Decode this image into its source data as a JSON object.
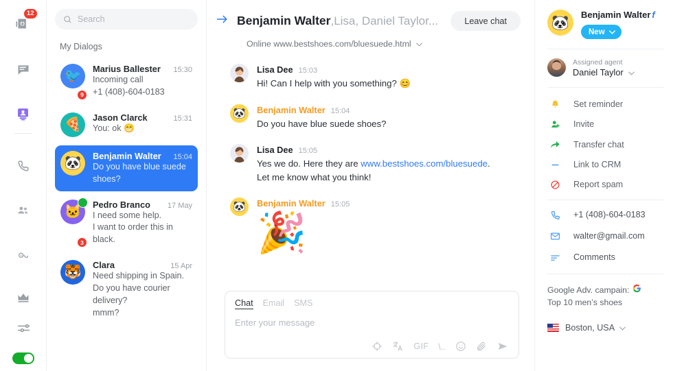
{
  "rail": {
    "items": [
      {
        "name": "inbox-icon",
        "badge": "12"
      },
      {
        "name": "chat-icon",
        "badge": ""
      },
      {
        "name": "contacts-icon",
        "badge": ""
      },
      {
        "name": "phone-icon",
        "badge": ""
      },
      {
        "name": "team-icon",
        "badge": ""
      },
      {
        "name": "analytics-icon",
        "badge": ""
      },
      {
        "name": "crown-icon",
        "badge": ""
      },
      {
        "name": "settings-sliders-icon",
        "badge": ""
      }
    ],
    "toggle_state": "on"
  },
  "search": {
    "placeholder": "Search",
    "value": ""
  },
  "dialogs": {
    "title": "My Dialogs",
    "items": [
      {
        "name": "Marius Ballester",
        "time": "15:30",
        "lines": [
          "Incoming call",
          "+1 (408)-604-0183"
        ],
        "avatar_emoji": "🐦",
        "avatar_color": "#4285f4",
        "badge": "9",
        "badge_color": "#f03a2e",
        "online": false,
        "selected": false
      },
      {
        "name": "Jason Clarck",
        "time": "15:31",
        "lines": [
          "You: ok 😁"
        ],
        "avatar_emoji": "🍕",
        "avatar_color": "#17b9b0",
        "badge": "",
        "badge_color": "",
        "online": false,
        "selected": false
      },
      {
        "name": "Benjamin Walter",
        "time": "15:04",
        "lines": [
          "Do you have blue suede",
          "shoes?"
        ],
        "avatar_emoji": "🐼",
        "avatar_color": "#ffd64d",
        "badge": "",
        "badge_color": "",
        "online": false,
        "selected": true
      },
      {
        "name": "Pedro Branco",
        "time": "17 May",
        "lines": [
          "I need some help.",
          "I want to order this in black."
        ],
        "avatar_emoji": "🐱",
        "avatar_color": "#8662f0",
        "badge": "3",
        "badge_color": "#f03a2e",
        "online": true,
        "selected": false
      },
      {
        "name": "Clara",
        "time": "15 Apr",
        "lines": [
          "Need shipping in Spain.",
          "Do you have courier delivery?",
          "mmm?"
        ],
        "avatar_emoji": "🐯",
        "avatar_color": "#2266dd",
        "badge": "",
        "badge_color": "",
        "online": false,
        "selected": false
      }
    ]
  },
  "chat": {
    "title_primary": "Benjamin Walter",
    "title_rest": ",Lisa, Daniel Taylor...",
    "leave_label": "Leave chat",
    "status": "Online www.bestshoes.com/bluesuede.html",
    "messages": [
      {
        "author": "Lisa Dee",
        "author_color": "default",
        "time": "15:03",
        "text": "Hi! Can I help with you something? 😊",
        "avatar_kind": "photo",
        "avatar_emoji": "",
        "avatar_color": "#e8eaf0",
        "link": "",
        "text_after_link": "",
        "second_line": "",
        "big_emoji": ""
      },
      {
        "author": "Benjamin Walter",
        "author_color": "orange",
        "time": "15:04",
        "text": "Do you have blue suede shoes?",
        "avatar_kind": "emoji",
        "avatar_emoji": "🐼",
        "avatar_color": "#ffd64d",
        "link": "",
        "text_after_link": "",
        "second_line": "",
        "big_emoji": ""
      },
      {
        "author": "Lisa Dee",
        "author_color": "default",
        "time": "15:05",
        "text": "Yes we do. Here they are ",
        "avatar_kind": "photo",
        "avatar_emoji": "",
        "avatar_color": "#e8eaf0",
        "link": "www.bestshoes.com/bluesuede",
        "text_after_link": ".",
        "second_line": "Let me know what you think!",
        "big_emoji": ""
      },
      {
        "author": "Benjamin Walter",
        "author_color": "orange",
        "time": "15:05",
        "text": "",
        "avatar_kind": "emoji",
        "avatar_emoji": "🐼",
        "avatar_color": "#ffd64d",
        "link": "",
        "text_after_link": "",
        "second_line": "",
        "big_emoji": "🎉"
      }
    ]
  },
  "composer": {
    "tabs": [
      {
        "label": "Chat",
        "active": true
      },
      {
        "label": "Email",
        "active": false
      },
      {
        "label": "SMS",
        "active": false
      }
    ],
    "placeholder": "Enter your message",
    "value": "",
    "tools": [
      {
        "name": "target-icon",
        "label": ""
      },
      {
        "name": "translate-icon",
        "label": ""
      },
      {
        "name": "gif-icon",
        "label": "GIF"
      },
      {
        "name": "shortcut-icon",
        "label": "\\.."
      },
      {
        "name": "emoji-icon",
        "label": ""
      },
      {
        "name": "attachment-icon",
        "label": ""
      },
      {
        "name": "send-icon",
        "label": ""
      }
    ]
  },
  "info": {
    "contact_name": "Benjamin Walter",
    "facebook_mark": "f",
    "avatar_emoji": "🐼",
    "status_pill": "New",
    "assigned_label": "Assigned agent",
    "assigned_name": "Daniel Taylor",
    "actions": [
      {
        "label": "Set reminder",
        "icon": "bell-icon",
        "color": "#f7c12f"
      },
      {
        "label": "Invite",
        "icon": "add-person-icon",
        "color": "#21b14a"
      },
      {
        "label": "Transfer chat",
        "icon": "transfer-arrow-icon",
        "color": "#21b14a"
      },
      {
        "label": "Link to CRM",
        "icon": "link-icon",
        "color": "#4a9bf5"
      },
      {
        "label": "Report spam",
        "icon": "block-icon",
        "color": "#f0483c"
      }
    ],
    "contact_rows": [
      {
        "label": "+1 (408)-604-0183",
        "icon": "phone-icon"
      },
      {
        "label": "walter@gmail.com",
        "icon": "mail-icon"
      },
      {
        "label": "Comments",
        "icon": "comments-icon"
      }
    ],
    "campaign_label": "Google Adv. campain:",
    "campaign_value": "Top 10 men’s shoes",
    "location": "Boston, USA"
  }
}
